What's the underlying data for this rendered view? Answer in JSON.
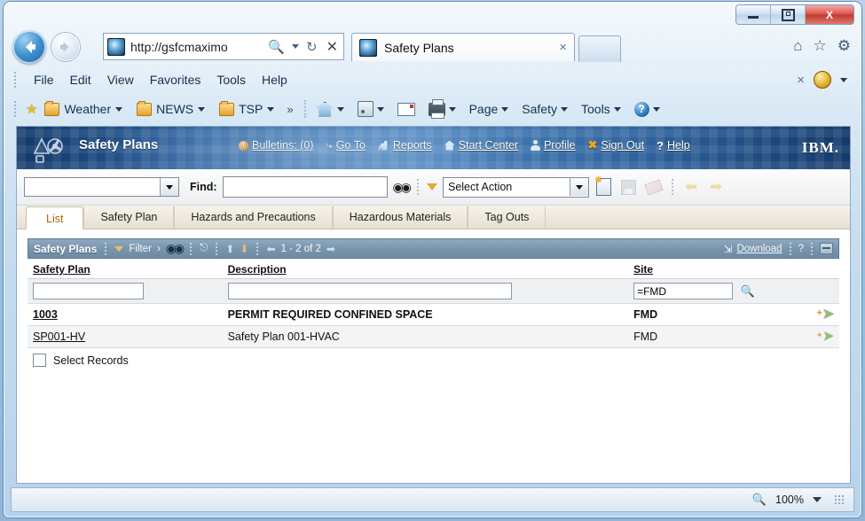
{
  "window": {
    "minimize_label": "Minimize",
    "maximize_label": "Maximize",
    "close_label": "X"
  },
  "browser": {
    "address": "http://gsfcmaximo",
    "search_icon": "search-icon",
    "dropdown_icon": "chevron-down-icon",
    "refresh_icon": "refresh-icon",
    "stop_icon": "close-icon",
    "tab_title": "Safety Plans",
    "tab_close": "×",
    "nav_right": [
      "⌂",
      "☆",
      "⚙"
    ],
    "menu": [
      "File",
      "Edit",
      "View",
      "Favorites",
      "Tools",
      "Help"
    ],
    "menu_right_close": "×",
    "favorites": [
      {
        "label": "Weather",
        "icon": "folder-icon"
      },
      {
        "label": "NEWS",
        "icon": "folder-icon"
      },
      {
        "label": "TSP",
        "icon": "folder-icon"
      }
    ],
    "favorites_overflow": "»",
    "command_bar": [
      {
        "label": "",
        "icon": "home-icon"
      },
      {
        "label": "",
        "icon": "rss-icon"
      },
      {
        "label": "",
        "icon": "mail-icon"
      },
      {
        "label": "",
        "icon": "print-icon"
      },
      {
        "label": "Page",
        "icon": ""
      },
      {
        "label": "Safety",
        "icon": ""
      },
      {
        "label": "Tools",
        "icon": ""
      },
      {
        "label": "",
        "icon": "help-icon"
      }
    ],
    "command_overflow": "»"
  },
  "maximo": {
    "app_title": "Safety Plans",
    "nav_links": [
      {
        "label": "Bulletins: (0)",
        "icon": "bulletin-icon"
      },
      {
        "label": "Go To",
        "icon": "goto-icon"
      },
      {
        "label": "Reports",
        "icon": "reports-icon"
      },
      {
        "label": "Start Center",
        "icon": "home-icon"
      },
      {
        "label": "Profile",
        "icon": "profile-icon"
      },
      {
        "label": "Sign Out",
        "icon": "signout-icon"
      },
      {
        "label": "Help",
        "icon": "help-icon"
      }
    ],
    "brand": "IBM.",
    "toolbar": {
      "query_select_value": "",
      "find_label": "Find:",
      "find_value": "",
      "find_placeholder": "",
      "binoculars_icon": "binoculars-icon",
      "filter_arrow_icon": "triangle-down-icon",
      "action_select_value": "Select Action",
      "new_record_icon": "new-record-icon",
      "save_icon": "save-icon",
      "clear_icon": "clear-changes-icon",
      "previous_icon": "previous-record-icon",
      "next_icon": "next-record-icon"
    },
    "tabs": [
      {
        "label": "List",
        "active": true
      },
      {
        "label": "Safety Plan",
        "active": false
      },
      {
        "label": "Hazards and Precautions",
        "active": false
      },
      {
        "label": "Hazardous Materials",
        "active": false
      },
      {
        "label": "Tag Outs",
        "active": false
      }
    ],
    "section": {
      "title": "Safety Plans",
      "filter_label": "Filter",
      "filter_sep": "›",
      "binoculars_icon": "binoculars-icon",
      "table_options_icon": "table-options-icon",
      "sort_up_icon": "arrow-up-icon",
      "sort_down_icon": "arrow-down-icon",
      "prev_page_icon": "arrow-left-icon",
      "paging_text": "1 - 2 of 2",
      "next_page_icon": "arrow-right-icon",
      "download_icon": "download-icon",
      "download_label": "Download",
      "help_label": "?",
      "minimize_icon": "minimize-section-icon"
    },
    "table": {
      "columns": [
        "Safety Plan",
        "Description",
        "Site"
      ],
      "filters": {
        "safety_plan": "",
        "description": "",
        "site": "=FMD"
      },
      "rows": [
        {
          "safety_plan": "1003",
          "description": "PERMIT REQUIRED CONFINED SPACE",
          "site": "FMD",
          "bold": true,
          "goto_icon": "goto-record-icon"
        },
        {
          "safety_plan": "SP001-HV",
          "description": "Safety Plan 001-HVAC",
          "site": "FMD",
          "bold": false,
          "goto_icon": "goto-record-icon"
        }
      ],
      "select_records_label": "Select Records",
      "select_records_checked": false
    }
  },
  "status": {
    "zoom_icon": "zoom-icon",
    "zoom_level": "100%",
    "zoom_caret": "chevron-down-icon"
  },
  "colors": {
    "maximo_header_blue": "#2a5f9c",
    "section_header_blue": "#7894ad",
    "active_tab_text": "#b0620c",
    "accent_orange": "#e8a33d"
  }
}
